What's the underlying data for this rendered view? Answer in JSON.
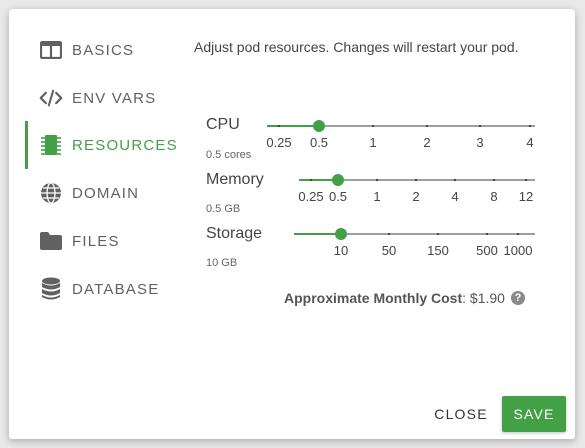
{
  "sidebar": {
    "items": [
      {
        "label": "BASICS",
        "icon": "columns-icon",
        "active": false
      },
      {
        "label": "ENV VARS",
        "icon": "code-icon",
        "active": false
      },
      {
        "label": "RESOURCES",
        "icon": "chip-icon",
        "active": true
      },
      {
        "label": "DOMAIN",
        "icon": "globe-icon",
        "active": false
      },
      {
        "label": "FILES",
        "icon": "folder-icon",
        "active": false
      },
      {
        "label": "DATABASE",
        "icon": "database-icon",
        "active": false
      }
    ]
  },
  "main": {
    "description": "Adjust pod resources. Changes will restart your pod.",
    "resources": [
      {
        "label": "CPU",
        "value_text": "0.5 cores",
        "ticks": [
          "0.25",
          "0.5",
          "1",
          "2",
          "3",
          "4"
        ],
        "selected": "0.5"
      },
      {
        "label": "Memory",
        "value_text": "0.5 GB",
        "ticks": [
          "0.25",
          "0.5",
          "1",
          "2",
          "4",
          "8",
          "12"
        ],
        "selected": "0.5"
      },
      {
        "label": "Storage",
        "value_text": "10 GB",
        "ticks": [
          "10",
          "50",
          "150",
          "500",
          "1000"
        ],
        "selected": "10"
      }
    ],
    "cost": {
      "label": "Approximate Monthly Cost",
      "separator": ": ",
      "value": "$1.90",
      "help": "?"
    }
  },
  "actions": {
    "close_label": "CLOSE",
    "save_label": "SAVE"
  },
  "colors": {
    "accent": "#43a047",
    "text": "#444444",
    "icon": "#616161"
  }
}
